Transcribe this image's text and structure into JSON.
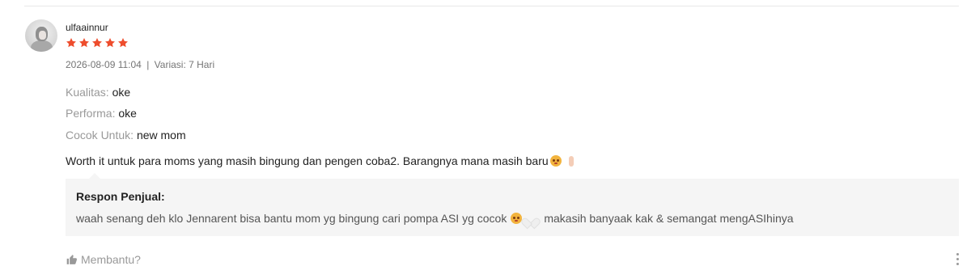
{
  "review": {
    "username": "ulfaainnur",
    "rating": 5,
    "timestamp": "2026-08-09 11:04",
    "separator": "|",
    "variant": "Variasi: 7 Hari",
    "attributes": [
      {
        "key": "Kualitas:",
        "value": "oke"
      },
      {
        "key": "Performa:",
        "value": "oke"
      },
      {
        "key": "Cocok Untuk:",
        "value": "new mom"
      }
    ],
    "comment": "Worth it untuk para moms yang masih bingung dan pengen coba2. Barangnya mana masih baru",
    "icons": {
      "star": "star-icon",
      "avatar": "user-avatar",
      "thumb": "thumbs-up-icon",
      "more": "more-vertical-icon"
    },
    "colors": {
      "star": "#ee4d2d",
      "muted": "#999999",
      "reply_bg": "#f5f5f5"
    }
  },
  "seller_reply": {
    "title": "Respon Penjual:",
    "text_part1": "waah senang deh klo Jennarent bisa bantu mom yg bingung cari pompa ASI yg cocok",
    "text_part2": "makasih banyaak kak & semangat mengASIhinya"
  },
  "actions": {
    "helpful_label": "Membantu?"
  }
}
